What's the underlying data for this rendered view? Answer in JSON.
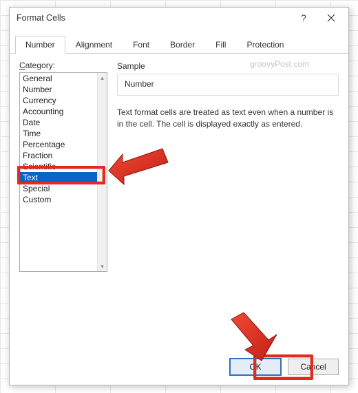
{
  "dialog": {
    "title": "Format Cells",
    "tabs": [
      "Number",
      "Alignment",
      "Font",
      "Border",
      "Fill",
      "Protection"
    ],
    "active_tab_index": 0,
    "category_label_prefix": "C",
    "category_label_rest": "ategory:",
    "categories": [
      "General",
      "Number",
      "Currency",
      "Accounting",
      "Date",
      "Time",
      "Percentage",
      "Fraction",
      "Scientific",
      "Text",
      "Special",
      "Custom"
    ],
    "selected_category_index": 9,
    "sample": {
      "label": "Sample",
      "value": "Number"
    },
    "description": "Text format cells are treated as text even when a number is in the cell. The cell is displayed exactly as entered.",
    "buttons": {
      "ok": "OK",
      "cancel": "Cancel"
    }
  },
  "watermark": "groovyPost.com"
}
